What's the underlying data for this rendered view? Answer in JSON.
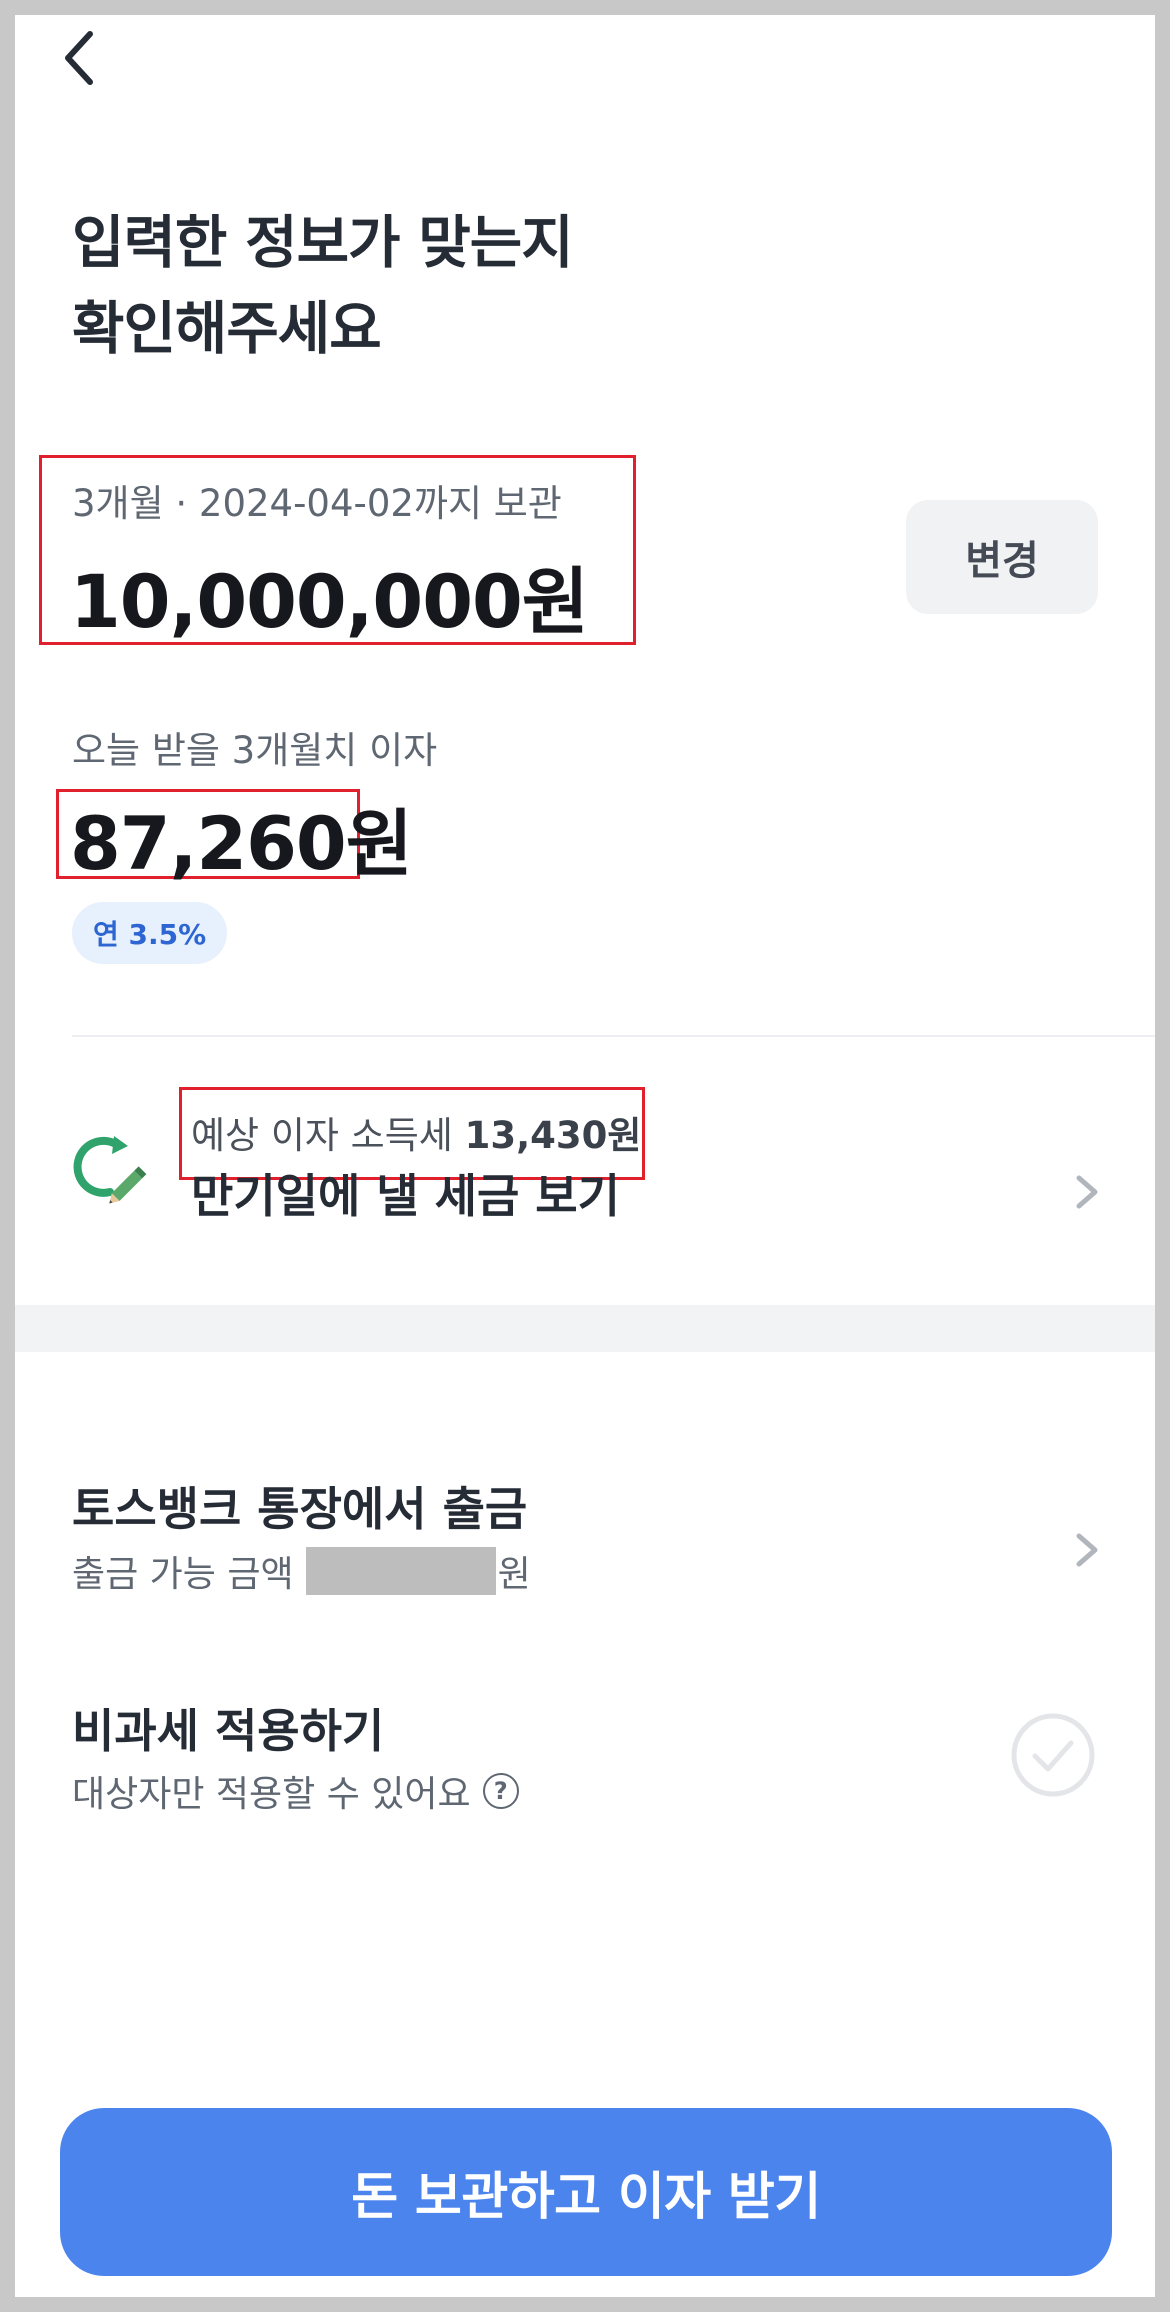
{
  "header": {
    "back_icon": "chevron-left-icon",
    "title": "입력한 정보가 맞는지\n확인해주세요"
  },
  "deposit": {
    "period_text": "3개월 · 2024-04-02까지 보관",
    "principal": "10,000,000원",
    "change_label": "변경"
  },
  "interest": {
    "caption": "오늘 받을 3개월치 이자",
    "amount": "87,260원",
    "rate_badge": "연 3.5%"
  },
  "tax": {
    "icon": "pencil-refresh-icon",
    "estimate_prefix": "예상 이자 소득세",
    "estimate_amount": "13,430원",
    "link_label": "만기일에 낼 세금 보기"
  },
  "withdraw": {
    "title": "토스뱅크 통장에서 출금",
    "available_prefix": "출금 가능 금액",
    "available_suffix": "원"
  },
  "tax_free": {
    "title": "비과세 적용하기",
    "subtitle": "대상자만 적용할 수 있어요",
    "help_glyph": "?",
    "checked": false
  },
  "cta": {
    "label": "돈 보관하고 이자 받기"
  },
  "colors": {
    "accent": "#4c84ee",
    "badge_bg": "#e7f0fd",
    "badge_text": "#2d65d2",
    "highlight_border": "#e0202c",
    "icon_green": "#2fa36b"
  }
}
